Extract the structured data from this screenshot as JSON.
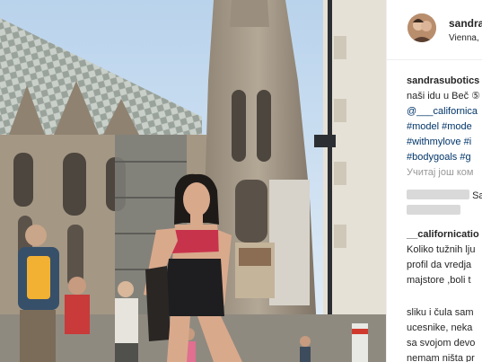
{
  "post": {
    "username": "sandra",
    "location": "Vienna,",
    "caption": {
      "author": "sandrasubotics",
      "line1": "naši idu u Beč ⑤",
      "line2": "@___californica",
      "line3": "#model #mode",
      "line4": "#withmylove #i",
      "line5": "#bodygoals #g"
    },
    "load_more": "Учитај још ком",
    "comments": [
      {
        "text": "Savr",
        "line2": ""
      },
      {
        "author": "__californicatio",
        "lines": [
          "Koliko tužnih lju",
          "profil da vredja",
          "majstore ,boli t"
        ]
      },
      {
        "lines": [
          "sliku i čula sam",
          "ucesnike, neka",
          "sa svojom devo",
          "nemam ništa pr"
        ]
      }
    ]
  }
}
